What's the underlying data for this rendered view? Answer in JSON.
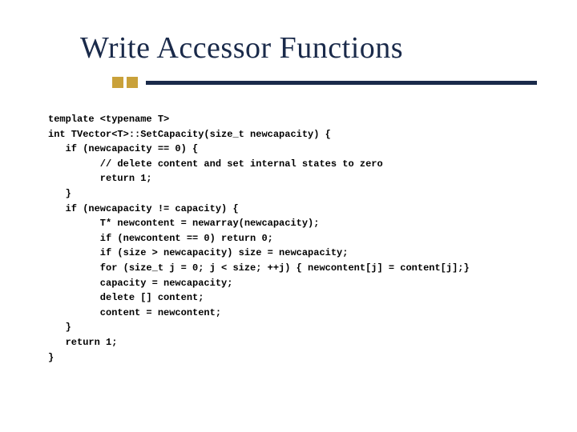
{
  "title": "Write Accessor Functions",
  "code": {
    "l01": "template <typename T>",
    "l02": "int TVector<T>::SetCapacity(size_t newcapacity) {",
    "l03": "   if (newcapacity == 0) {",
    "l04": "         // delete content and set internal states to zero",
    "l05": "         return 1;",
    "l06": "   }",
    "l07": "   if (newcapacity != capacity) {",
    "l08": "         T* newcontent = newarray(newcapacity);",
    "l09": "         if (newcontent == 0) return 0;",
    "l10": "         if (size > newcapacity) size = newcapacity;",
    "l11": "         for (size_t j = 0; j < size; ++j) { newcontent[j] = content[j];}",
    "l12": "         capacity = newcapacity;",
    "l13": "         delete [] content;",
    "l14": "         content = newcontent;",
    "l15": "   }",
    "l16": "   return 1;",
    "l17": "}"
  }
}
